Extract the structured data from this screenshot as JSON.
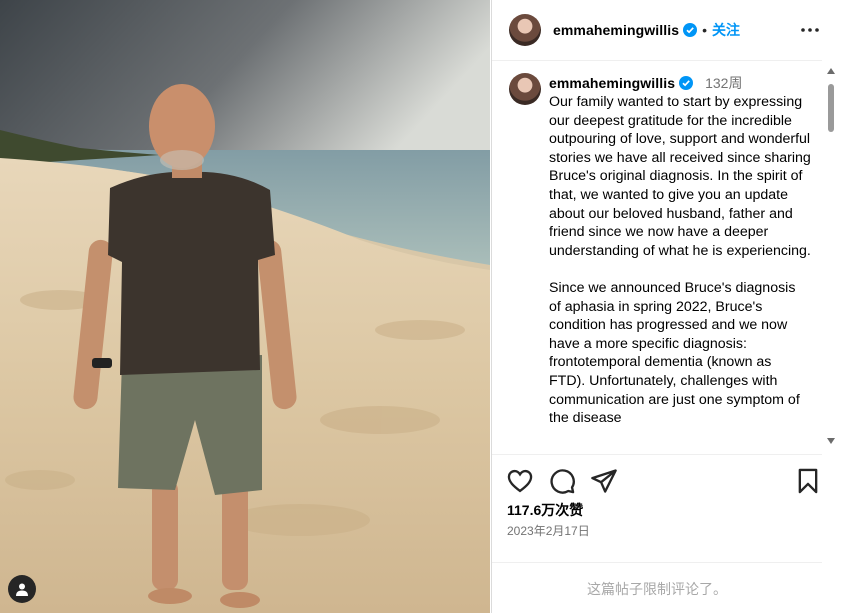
{
  "post": {
    "username": "emmahemingwillis",
    "separator": "•",
    "follow_label": "关注",
    "time_ago": "132周",
    "caption": "Our family wanted to start by expressing our deepest gratitude for the incredible outpouring of love, support and wonderful stories we have all received since sharing Bruce's original diagnosis. In the spirit of that, we wanted to give you an update about our beloved husband, father and friend since we now have a deeper understanding of what he is experiencing.\n\nSince we announced Bruce's diagnosis of aphasia in spring 2022, Bruce's condition has progressed and we now have a more specific diagnosis: frontotemporal dementia (known as FTD). Unfortunately, challenges with communication are just one symptom of the disease",
    "likes": "117.6万次赞",
    "date": "2023年2月17日",
    "comments_limited": "这篇帖子限制评论了。"
  },
  "icons": {
    "verified": "verified-badge-icon",
    "more": "more-options-icon",
    "like": "heart-icon",
    "comment": "comment-icon",
    "share": "share-icon",
    "save": "bookmark-icon",
    "user_tag": "user-tag-icon"
  },
  "colors": {
    "accent": "#0095f6",
    "muted": "#737373",
    "verified": "#0095f6"
  }
}
